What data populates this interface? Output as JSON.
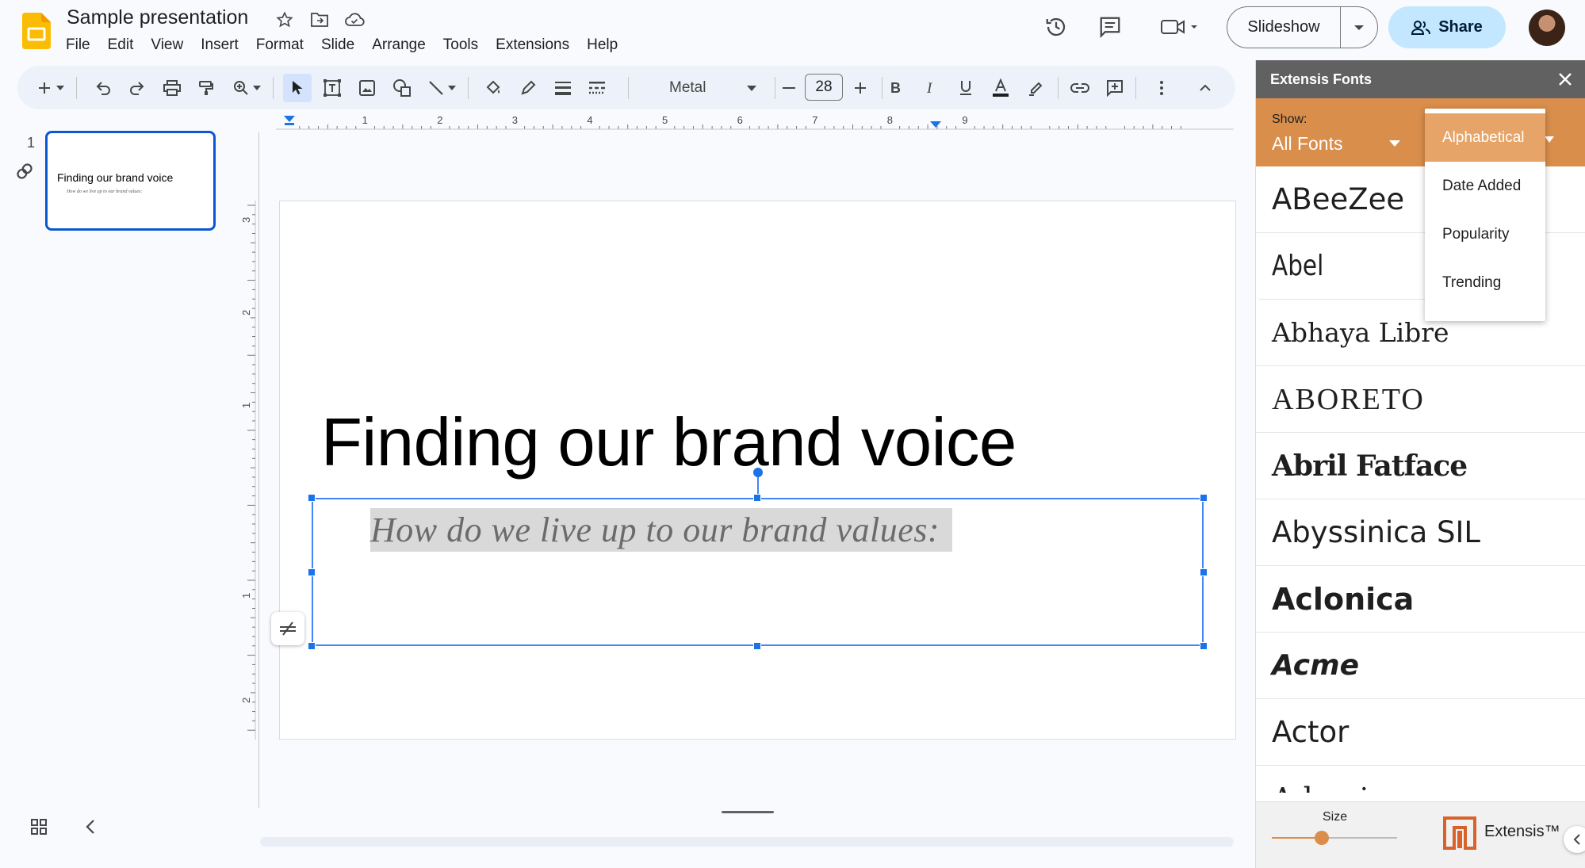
{
  "app": {
    "doc_title": "Sample presentation",
    "menu": [
      "File",
      "Edit",
      "View",
      "Insert",
      "Format",
      "Slide",
      "Arrange",
      "Tools",
      "Extensions",
      "Help"
    ],
    "slideshow_label": "Slideshow",
    "share_label": "Share",
    "brand_color": "#fbbc04",
    "accent": "#0b57d0"
  },
  "toolbar": {
    "font_name": "Metal",
    "font_size": "28"
  },
  "filmstrip": {
    "slide_number": "1",
    "thumb_title": "Finding our brand voice",
    "thumb_subtitle": "How do we live up to our brand values:"
  },
  "rulers": {
    "h_labels": [
      "1",
      "2",
      "3",
      "4",
      "5",
      "6",
      "7",
      "8",
      "9"
    ],
    "v_labels": [
      "3",
      "2",
      "1",
      "1",
      "2"
    ]
  },
  "slide": {
    "title": "Finding our brand voice",
    "subtitle": "How do we live up to our brand values:"
  },
  "panel": {
    "title": "Extensis Fonts",
    "show_label": "Show:",
    "show_value": "All Fonts",
    "accent_color": "#d98e4b",
    "sort_options": [
      "Alphabetical",
      "Date Added",
      "Popularity",
      "Trending"
    ],
    "sort_selected": "Alphabetical",
    "fonts": [
      "ABeeZee",
      "Abel",
      "Abhaya Libre",
      "ABORETO",
      "Abril Fatface",
      "Abyssinica  SIL",
      "Aclonica",
      "Acme",
      "Actor",
      "Adamina"
    ],
    "size_label": "Size",
    "size_value": 0.4,
    "brand": "Extensis™"
  }
}
